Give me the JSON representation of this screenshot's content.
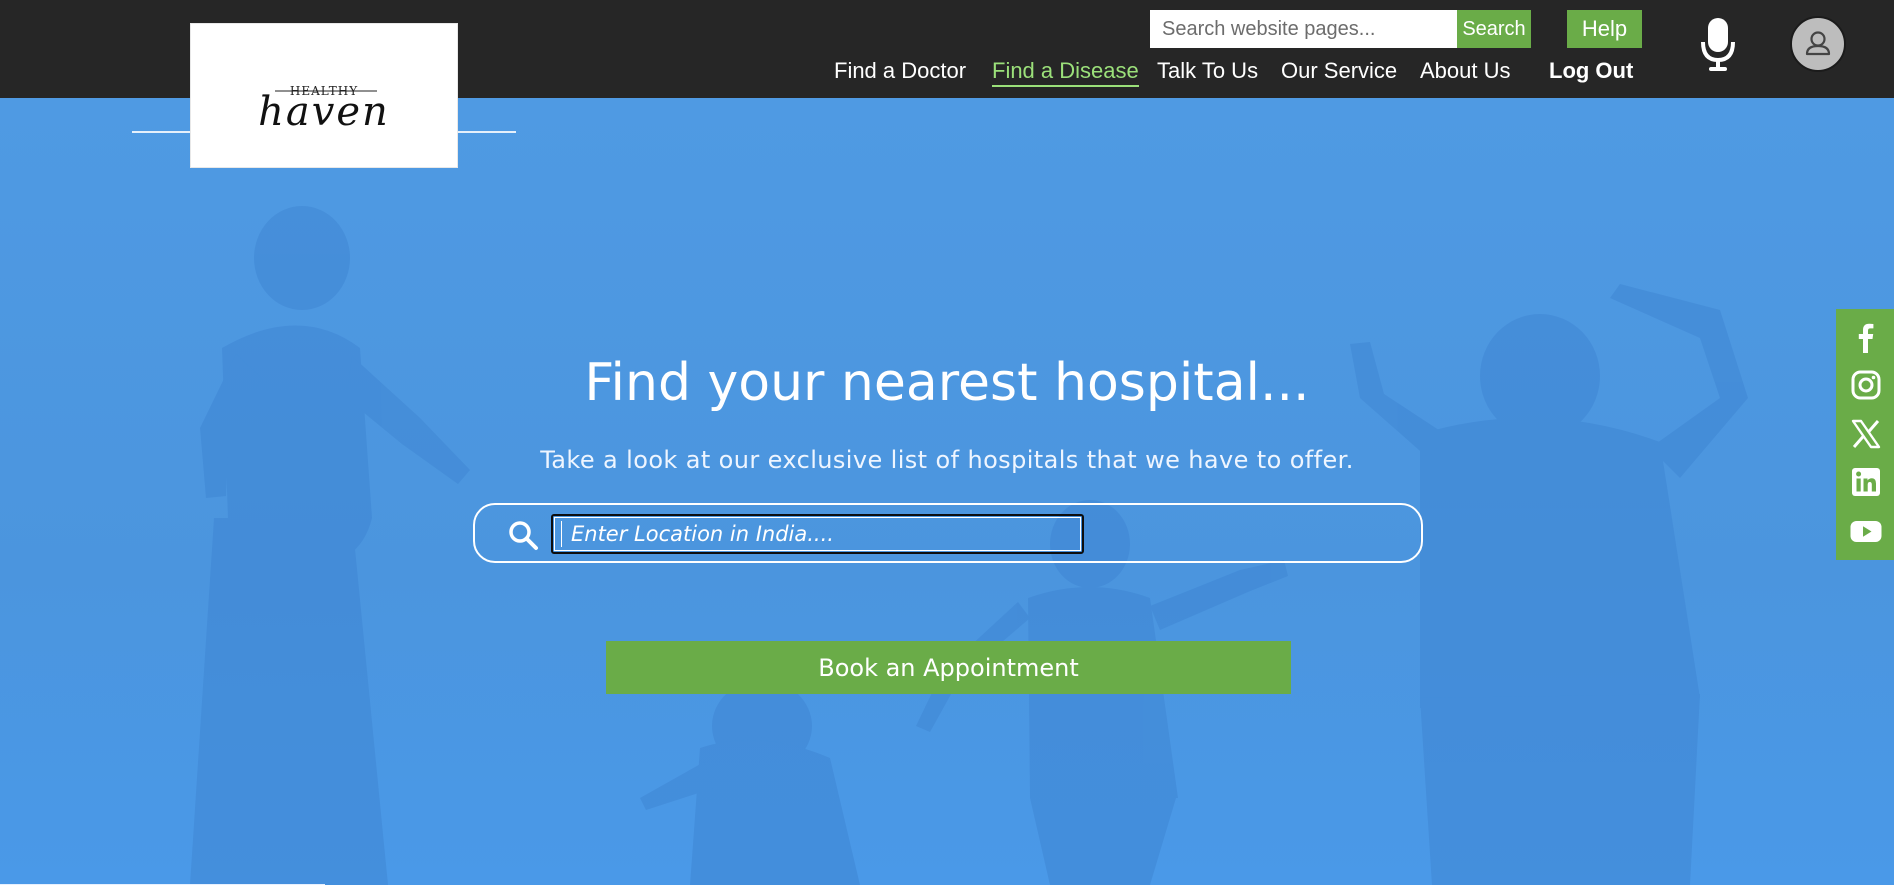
{
  "brand": {
    "logo_top": "HEALTHY",
    "logo_script": "haven"
  },
  "header": {
    "search": {
      "placeholder": "Search website pages...",
      "button_label": "Search"
    },
    "help_label": "Help",
    "nav": [
      {
        "label": "Find a Doctor",
        "active": false
      },
      {
        "label": "Find a Disease",
        "active": true
      },
      {
        "label": "Talk To Us",
        "active": false
      },
      {
        "label": "Our Service",
        "active": false
      },
      {
        "label": "About Us",
        "active": false
      },
      {
        "label": "Log Out",
        "active": false
      }
    ]
  },
  "hero": {
    "title": "Find your nearest hospital...",
    "subtitle": "Take a look at our exclusive list of hospitals that we have to offer.",
    "location": {
      "placeholder": "Enter Location in India....",
      "value": ""
    },
    "cta_label": "Book an Appointment"
  },
  "social": [
    "facebook-icon",
    "instagram-icon",
    "x-icon",
    "linkedin-icon",
    "youtube-icon"
  ],
  "colors": {
    "header_bg": "#262626",
    "accent_green": "#6aac48",
    "active_nav": "#9be07a",
    "hero_blue": "#4a97e0"
  }
}
